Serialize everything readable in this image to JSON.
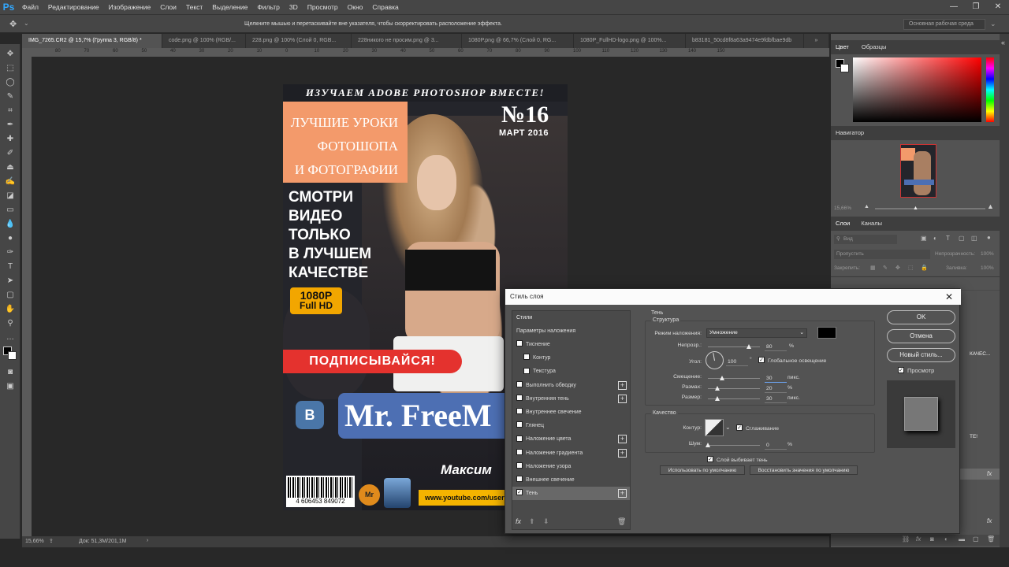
{
  "app": {
    "logo": "Ps"
  },
  "menu": [
    "Файл",
    "Редактирование",
    "Изображение",
    "Слои",
    "Текст",
    "Выделение",
    "Фильтр",
    "3D",
    "Просмотр",
    "Окно",
    "Справка"
  ],
  "window_controls": [
    "—",
    "❐",
    "✕"
  ],
  "options": {
    "hint": "Щелкните мышью и перетаскивайте вне указателя, чтобы скорректировать расположение эффекта.",
    "workspace": "Основная рабочая среда"
  },
  "tabs": [
    {
      "label": "IMG_7265.CR2 @ 15,7% (Группа 3, RGB/8) *",
      "active": true
    },
    {
      "label": "code.png @ 100% (RGB/...",
      "active": false
    },
    {
      "label": "228.png @ 100% (Слой 0, RGB...",
      "active": false
    },
    {
      "label": "228никого не просим.png @ 3...",
      "active": false
    },
    {
      "label": "1080P.png @ 66,7% (Слой 0, RG...",
      "active": false
    },
    {
      "label": "1080P_FullHD-logo.png @ 100%...",
      "active": false
    },
    {
      "label": "b83181_50cd8f8a63a9474e9fdbfbae9db",
      "active": false
    }
  ],
  "ruler_marks": [
    "80",
    "70",
    "60",
    "50",
    "40",
    "30",
    "20",
    "10",
    "0",
    "10",
    "20",
    "30",
    "40",
    "50",
    "60",
    "70",
    "80",
    "90",
    "100",
    "110",
    "120",
    "130",
    "140",
    "150"
  ],
  "status": {
    "zoom": "15,66%",
    "doc": "Док: 51,3M/201,1M"
  },
  "poster": {
    "top_banner": "ИЗУЧАЕМ ADOBE PHOTOSHOP ВМЕСТЕ!",
    "orange_lines": [
      "ЛУЧШИЕ УРОКИ",
      "ФОТОШОПА",
      "И ФОТОГРАФИИ"
    ],
    "issue": "№16",
    "issue_date": "МАРТ 2016",
    "big_lines": [
      "СМОТРИ",
      "ВИДЕО",
      "ТОЛЬКО",
      "В ЛУЧШЕМ",
      "КАЧЕСТВЕ"
    ],
    "hd_top": "1080P",
    "hd_bottom": "Full HD",
    "subscribe": "ПОДПИСЫВАЙСЯ!",
    "vk": "В",
    "brand": "Mr. FreeM",
    "author": "Максим",
    "barcode_number": "4 606453 849072",
    "round_logo": "Mr",
    "youtube": "www.youtube.com/user"
  },
  "right_panels": {
    "color_tabs": [
      "Цвет",
      "Образцы"
    ],
    "navigator": "Навигатор",
    "navigator_zoom": "15,66%",
    "layers_tabs": [
      "Слои",
      "Каналы"
    ],
    "layers_search": "Вид",
    "blend": "Пропустить",
    "opacity_label": "Непрозрачность:",
    "opacity_value": "100%",
    "lock_label": "Закрепить:",
    "fill_label": "Заливка:",
    "fill_value": "100%",
    "partial1": "КАЧЕС...",
    "partial2": "ТЕ!"
  },
  "dialog": {
    "title": "Стиль слоя",
    "styles_header": "Стили",
    "blend_params": "Параметры наложения",
    "styles": [
      {
        "label": "Тиснение",
        "checked": false,
        "plus": false,
        "indent": false
      },
      {
        "label": "Контур",
        "checked": false,
        "plus": false,
        "indent": true
      },
      {
        "label": "Текстура",
        "checked": false,
        "plus": false,
        "indent": true
      },
      {
        "label": "Выполнить обводку",
        "checked": false,
        "plus": true,
        "indent": false
      },
      {
        "label": "Внутренняя тень",
        "checked": false,
        "plus": true,
        "indent": false
      },
      {
        "label": "Внутреннее свечение",
        "checked": false,
        "plus": false,
        "indent": false
      },
      {
        "label": "Глянец",
        "checked": false,
        "plus": false,
        "indent": false
      },
      {
        "label": "Наложение цвета",
        "checked": false,
        "plus": true,
        "indent": false
      },
      {
        "label": "Наложение градиента",
        "checked": false,
        "plus": true,
        "indent": false
      },
      {
        "label": "Наложение узора",
        "checked": false,
        "plus": false,
        "indent": false
      },
      {
        "label": "Внешнее свечение",
        "checked": false,
        "plus": false,
        "indent": false
      },
      {
        "label": "Тень",
        "checked": true,
        "plus": true,
        "indent": false
      }
    ],
    "section": "Тень",
    "structure": "Структура",
    "blend_mode_label": "Режим наложения:",
    "blend_mode": "Умножение",
    "shadow_color": "#000000",
    "opacity_label": "Непрозр.:",
    "opacity": "80",
    "opacity_pct": 80,
    "angle_label": "Угол:",
    "angle": "100",
    "angle_unit": "°",
    "global_light": "Глобальное освещение",
    "distance_label": "Смещение:",
    "distance": "30",
    "distance_unit": "пикс.",
    "spread_label": "Размах:",
    "spread": "20",
    "spread_unit": "%",
    "size_label": "Размер:",
    "size": "30",
    "size_unit": "пикс.",
    "pct": "%",
    "quality": "Качество",
    "contour_label": "Контур:",
    "antialias": "Сглаживание",
    "noise_label": "Шум:",
    "noise": "0",
    "knockout": "Слой выбивает тень",
    "default_btn": "Использовать по умолчанию",
    "reset_btn": "Восстановить значения по умолчанию",
    "ok": "OK",
    "cancel": "Отмена",
    "new_style": "Новый стиль...",
    "preview": "Просмотр",
    "fx": "fx"
  }
}
